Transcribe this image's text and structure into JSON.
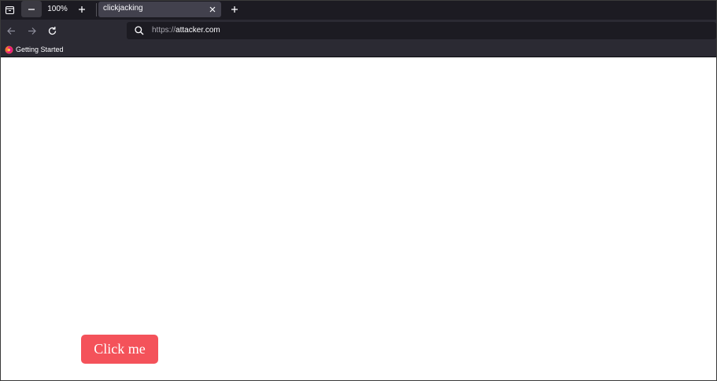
{
  "colors": {
    "tabstrip_bg": "#1c1b22",
    "toolbar_bg": "#2b2a33",
    "active_tab_bg": "#42414d",
    "button_bg": "#f4525a",
    "button_text": "#ffffff"
  },
  "tabstrip": {
    "tab_list_icon": "tab-list-icon",
    "zoom": {
      "minus_icon": "minus-icon",
      "level": "100%",
      "plus_icon": "plus-icon"
    },
    "tabs": [
      {
        "title": "clickjacking",
        "close_icon": "close-icon",
        "active": true
      }
    ],
    "new_tab_icon": "plus-icon"
  },
  "navbar": {
    "back_icon": "arrow-left-icon",
    "forward_icon": "arrow-right-icon",
    "reload_icon": "reload-icon",
    "url": {
      "search_icon": "search-icon",
      "scheme": "https://",
      "host": "attacker.com"
    }
  },
  "bookmarks": {
    "items": [
      {
        "label": "Getting Started",
        "icon": "firefox-icon"
      }
    ]
  },
  "page": {
    "button_label": "Click me"
  }
}
